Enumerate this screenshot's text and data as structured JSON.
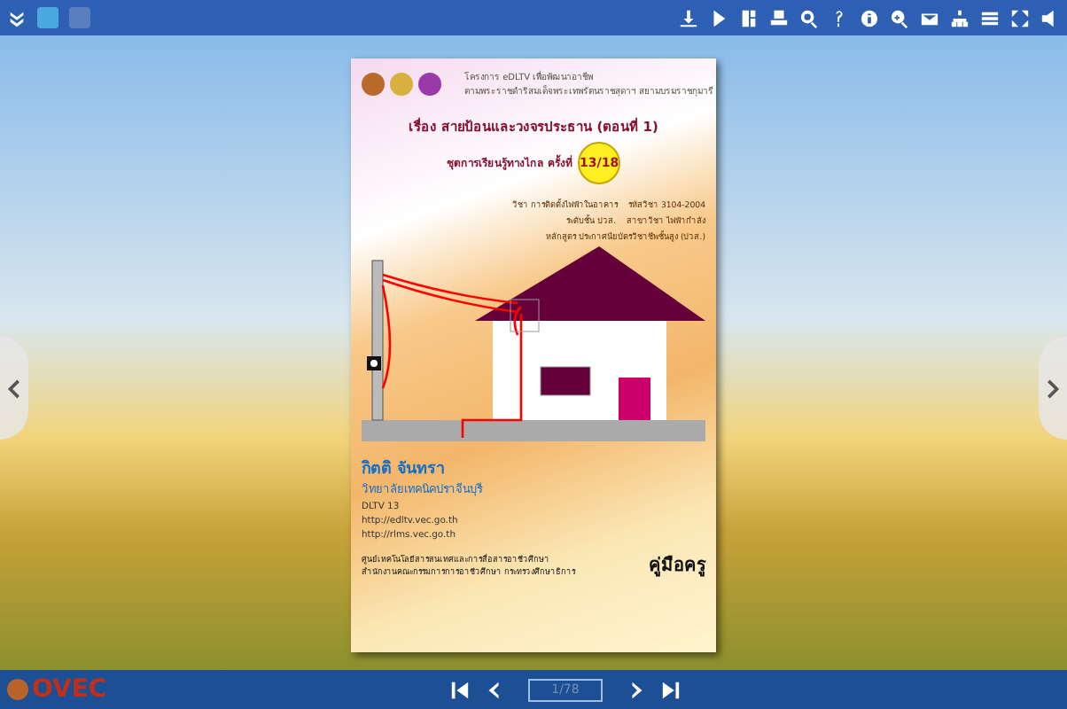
{
  "book": {
    "header": {
      "project": "โครงการ eDLTV เพื่อพัฒนาอาชีพ",
      "patron": "ตามพระราชดำริสมเด็จพระเทพรัตนราชสุดาฯ สยามบรมราชกุมารี"
    },
    "title": "เรื่อง สายป้อนและวงจรประธาน (ตอนที่ 1)",
    "series": "ชุดการเรียนรู้ทางไกล ครั้งที่",
    "series_number": "13/18",
    "info": [
      {
        "label": "วิชา การติดตั้งไฟฟ้าในอาคาร",
        "value": "รหัสวิชา 3104-2004"
      },
      {
        "label": "ระดับชั้น ปวส.",
        "value": "สาขาวิชา ไฟฟ้ากำลัง"
      },
      {
        "label": "หลักสูตร ประกาศนียบัตรวิชาชีพชั้นสูง (ปวส.)"
      }
    ],
    "author": "กิตติ จันทรา",
    "college": "วิทยาลัยเทคนิคปราจีนบุรี",
    "links": [
      "DLTV 13",
      "http://edltv.vec.go.th",
      "http://rlms.vec.go.th"
    ],
    "publisher": [
      "ศูนย์เทคโนโลยีสารสนเทศและการสื่อสารอาชีวศึกษา",
      "สำนักงานคณะกรรมการการอาชีวศึกษา กระทรวงศึกษาธิการ"
    ],
    "badge": "คู่มือครู"
  },
  "footer": {
    "logo": "OVEC",
    "page": "1/78"
  }
}
